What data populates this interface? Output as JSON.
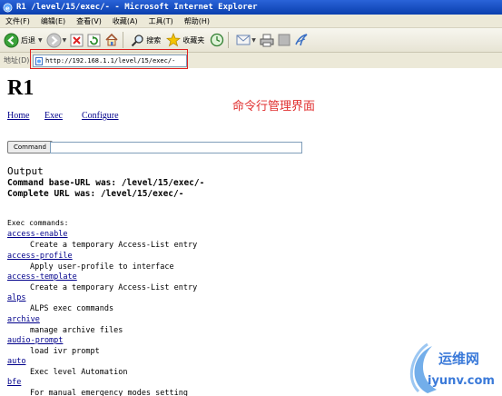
{
  "window": {
    "title": "R1 /level/15/exec/- - Microsoft Internet Explorer"
  },
  "menu": [
    "文件(F)",
    "编辑(E)",
    "查看(V)",
    "收藏(A)",
    "工具(T)",
    "帮助(H)"
  ],
  "toolbar": {
    "back": "后退",
    "search": "搜索",
    "favorites": "收藏夹"
  },
  "address": {
    "label": "地址(D)",
    "url": "http://192.168.1.1/level/15/exec/-"
  },
  "page": {
    "heading": "R1",
    "annotation": "命令行管理界面",
    "nav": [
      "Home",
      "Exec",
      "Configure"
    ],
    "command_button": "Command",
    "command_value": "",
    "output_heading": "Output",
    "output_lines": [
      "Command base-URL was: /level/15/exec/-",
      "Complete URL was: /level/15/exec/-"
    ],
    "exec_title": "Exec commands:",
    "commands": [
      {
        "name": "access-enable",
        "desc": "Create a temporary Access-List entry"
      },
      {
        "name": "access-profile",
        "desc": "Apply user-profile to interface"
      },
      {
        "name": "access-template",
        "desc": "Create a temporary Access-List entry"
      },
      {
        "name": "alps",
        "desc": "ALPS exec commands"
      },
      {
        "name": "archive",
        "desc": "manage archive files"
      },
      {
        "name": "audio-prompt",
        "desc": "load ivr prompt"
      },
      {
        "name": "auto",
        "desc": "Exec level Automation"
      },
      {
        "name": "bfe",
        "desc": "For manual emergency modes setting"
      }
    ]
  },
  "watermark": {
    "brand": "运维网",
    "site": "iyunv.com"
  }
}
